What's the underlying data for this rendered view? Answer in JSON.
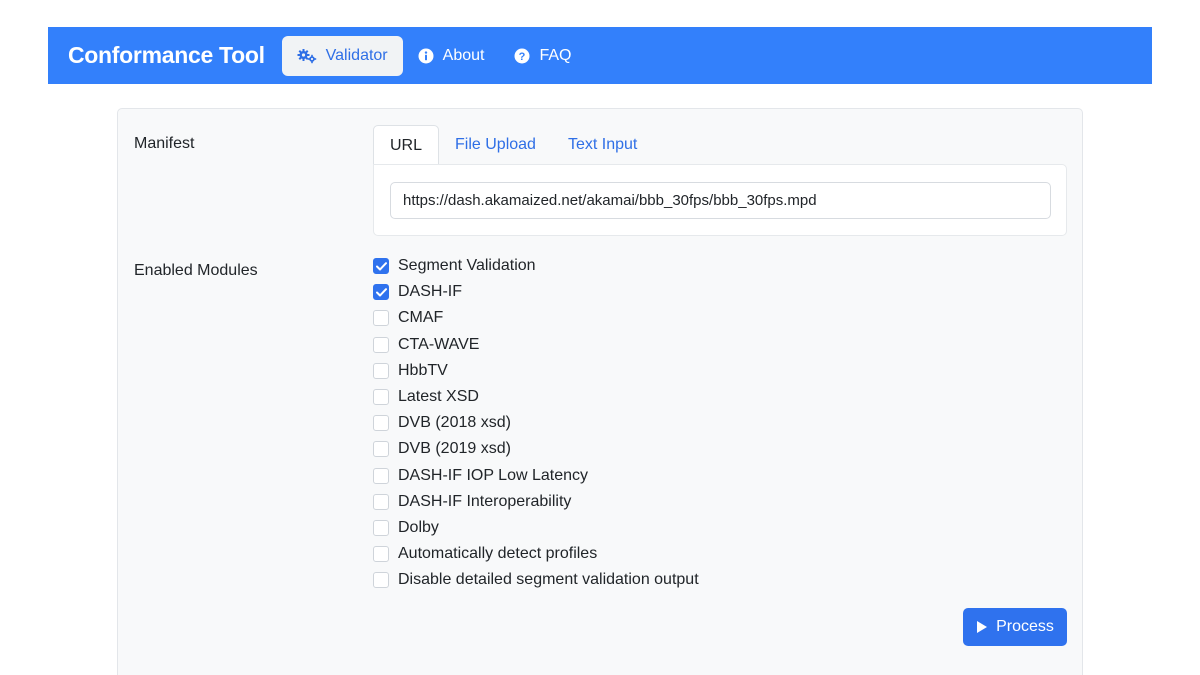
{
  "navbar": {
    "brand": "Conformance Tool",
    "items": [
      {
        "label": "Validator",
        "icon": "gears-icon",
        "active": true
      },
      {
        "label": "About",
        "icon": "info-circle-icon",
        "active": false
      },
      {
        "label": "FAQ",
        "icon": "question-circle-icon",
        "active": false
      }
    ]
  },
  "manifest": {
    "label": "Manifest",
    "tabs": [
      {
        "label": "URL",
        "active": true
      },
      {
        "label": "File Upload",
        "active": false
      },
      {
        "label": "Text Input",
        "active": false
      }
    ],
    "url_value": "https://dash.akamaized.net/akamai/bbb_30fps/bbb_30fps.mpd"
  },
  "modules": {
    "label": "Enabled Modules",
    "items": [
      {
        "label": "Segment Validation",
        "checked": true
      },
      {
        "label": "DASH-IF",
        "checked": true
      },
      {
        "label": "CMAF",
        "checked": false
      },
      {
        "label": "CTA-WAVE",
        "checked": false
      },
      {
        "label": "HbbTV",
        "checked": false
      },
      {
        "label": "Latest XSD",
        "checked": false
      },
      {
        "label": "DVB (2018 xsd)",
        "checked": false
      },
      {
        "label": "DVB (2019 xsd)",
        "checked": false
      },
      {
        "label": "DASH-IF IOP Low Latency",
        "checked": false
      },
      {
        "label": "DASH-IF Interoperability",
        "checked": false
      },
      {
        "label": "Dolby",
        "checked": false
      },
      {
        "label": "Automatically detect profiles",
        "checked": false
      },
      {
        "label": "Disable detailed segment validation output",
        "checked": false
      }
    ]
  },
  "actions": {
    "process_label": "Process",
    "process_icon": "play-icon"
  },
  "colors": {
    "navbar": "#3380fb",
    "primary": "#2f72ee",
    "link": "#2f6fe6"
  }
}
